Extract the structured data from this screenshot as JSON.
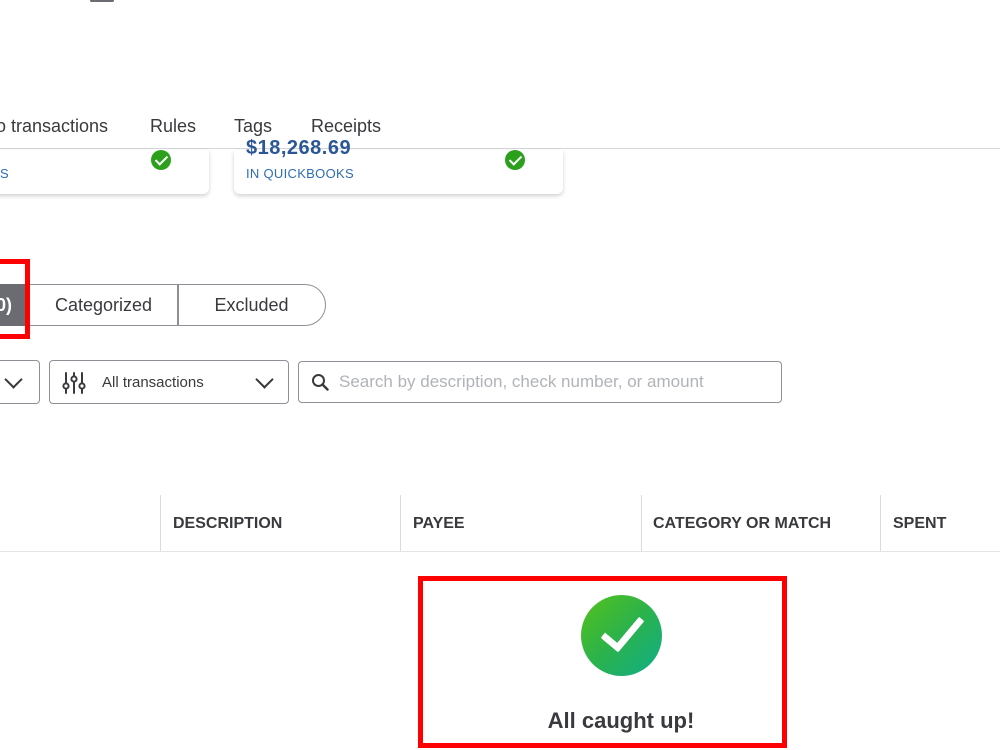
{
  "subnav": {
    "tabs": [
      {
        "label": "o transactions"
      },
      {
        "label": "Rules"
      },
      {
        "label": "Tags"
      },
      {
        "label": "Receipts"
      }
    ]
  },
  "cards": {
    "left": {
      "label": "S"
    },
    "right": {
      "amount": "$18,268.69",
      "label": "IN QUICKBOOKS"
    }
  },
  "segments": {
    "active_label": "0)",
    "categorized_label": "Categorized",
    "excluded_label": "Excluded"
  },
  "filters": {
    "transaction_filter_value": "All transactions",
    "search_placeholder": "Search by description, check number, or amount"
  },
  "table": {
    "columns": [
      "DESCRIPTION",
      "PAYEE",
      "CATEGORY OR MATCH",
      "SPENT"
    ]
  },
  "empty_state": {
    "message": "All caught up!"
  },
  "colors": {
    "accent_red": "#ff0000",
    "success_green": "#2ca01c",
    "link_blue": "#2f6db5"
  }
}
